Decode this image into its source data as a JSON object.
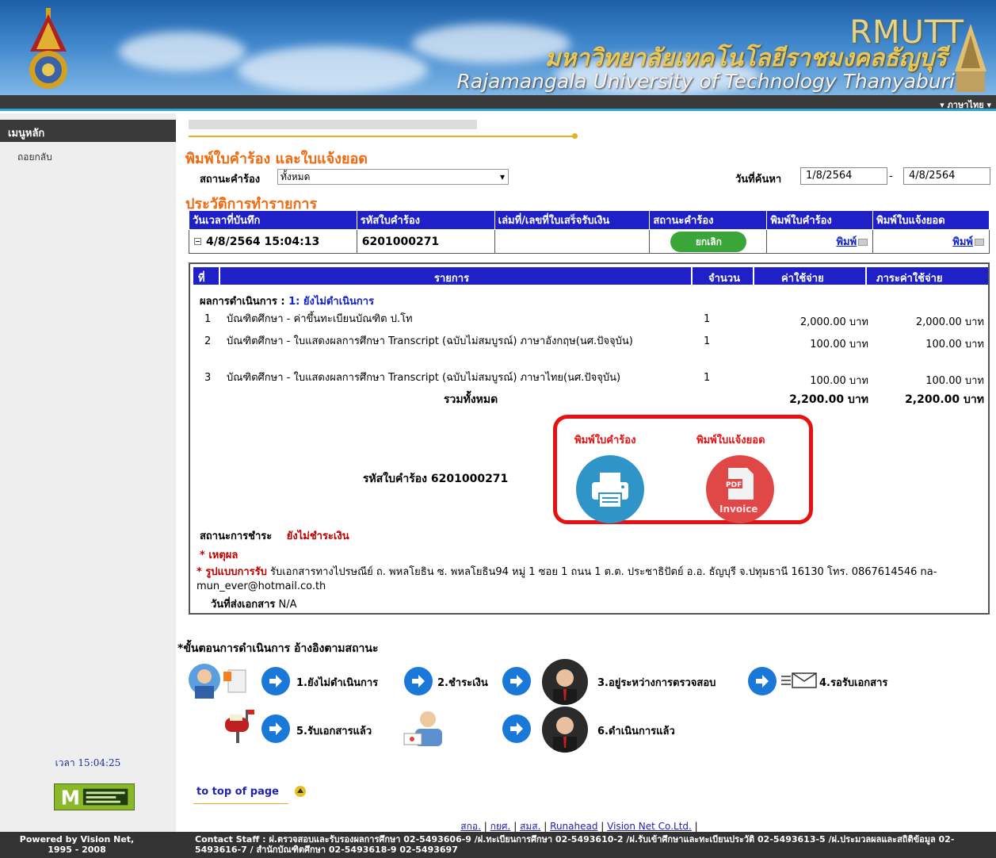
{
  "header": {
    "brand_short": "RMUTT",
    "brand_thai": "มหาวิทยาลัยเทคโนโลยีราชมงคลธัญบุรี",
    "brand_en": "Rajamangala University of Technology Thanyaburi",
    "language": "▾ ภาษาไทย ▾"
  },
  "sidebar": {
    "menu_title": "เมนูหลัก",
    "back": "ถอยกลับ",
    "clock": "เวลา 15:04:25"
  },
  "main": {
    "title": "พิมพ์ใบคำร้อง และใบแจ้งยอด",
    "filter": {
      "status_label": "สถานะคำร้อง",
      "status_value": "ทั้งหมด",
      "date_label": "วันที่ค้นหา",
      "date_from": "1/8/2564",
      "date_sep": "-",
      "date_to": "4/8/2564"
    },
    "history_title": "ประวัติการทำรายการ",
    "history_headers": [
      "วันเวลาที่บันทึก",
      "รหัสใบคำร้อง",
      "เล่มที่/เลขที่ใบเสร็จรับเงิน",
      "สถานะคำร้อง",
      "พิมพ์ใบคำร้อง",
      "พิมพ์ใบแจ้งยอด"
    ],
    "history_row": {
      "datetime": "4/8/2564 15:04:13",
      "request_id": "6201000271",
      "receipt": "",
      "cancel_label": "ยกเลิก",
      "print_request": "พิมพ์",
      "print_invoice": "พิมพ์"
    },
    "items_headers": [
      "ที่",
      "รายการ",
      "จำนวน",
      "ค่าใช้จ่าย",
      "ภาระค่าใช้จ่าย"
    ],
    "step_result_label": "ผลการดำเนินการ :",
    "step_result_value": "1: ยังไม่ดำเนินการ",
    "items": [
      {
        "no": "1",
        "desc": "บัณฑิตศึกษา - ค่าขึ้นทะเบียนบัณฑิต ป.โท",
        "qty": "1",
        "cost": "2,000.00 บาท",
        "total": "2,000.00 บาท"
      },
      {
        "no": "2",
        "desc": "บัณฑิตศึกษา - ใบแสดงผลการศึกษา Transcript (ฉบับไม่สมบูรณ์) ภาษาอังกฤษ(นศ.ปัจจุบัน)",
        "qty": "1",
        "cost": "100.00 บาท",
        "total": "100.00 บาท"
      },
      {
        "no": "3",
        "desc": "บัณฑิตศึกษา - ใบแสดงผลการศึกษา Transcript (ฉบับไม่สมบูรณ์) ภาษาไทย(นศ.ปัจจุบัน)",
        "qty": "1",
        "cost": "100.00 บาท",
        "total": "100.00 บาท"
      }
    ],
    "sum_label": "รวมทั้งหมด",
    "sum_cost": "2,200.00 บาท",
    "sum_total": "2,200.00 บาท",
    "request_code_text": "รหัสใบคำร้อง 6201000271",
    "print_request_label": "พิมพ์ใบคำร้อง",
    "print_invoice_label": "พิมพ์ใบแจ้งยอด",
    "pdf_text": "PDF",
    "invoice_text": "Invoice",
    "pay_status_label": "สถานะการชำระ",
    "pay_status_value": "ยังไม่ชำระเงิน",
    "reason_label": "* เหตุผล",
    "ship_label": "* รูปแบบการรับ",
    "ship_text": "รับเอกสารทางไปรษณีย์ ถ. พหลโยธิน ซ. พหลโยธิน94 หมู่ 1 ซอย 1 ถนน 1 ต.ต. ประชาธิปัตย์ อ.อ. ธัญบุรี จ.ปทุมธานี 16130 โทร. 0867614546 na-mun_ever@hotmail.co.th",
    "send_date_label": "วันที่ส่งเอกสาร",
    "send_date_value": "N/A",
    "process_title": "*ขั้นตอนการดำเนินการ อ้างอิงตามสถานะ",
    "steps": [
      "1.ยังไม่ดำเนินการ",
      "2.ชำระเงิน",
      "3.อยู่ระหว่างการตรวจสอบ",
      "4.รอรับเอกสาร",
      "5.รับเอกสารแล้ว",
      "6.ดำเนินการแล้ว"
    ],
    "top_link": "to top of page",
    "footer_links": [
      "สกอ.",
      "กยศ.",
      "สมส.",
      "Runahead",
      "Vision Net Co.Ltd."
    ],
    "footer_link_sep": "|"
  },
  "footer": {
    "left": "Powered by Vision Net, 1995 - 2008",
    "right": "Contact Staff : ฝ.ตรวจสอบและรับรองผลการศึกษา 02-5493606-9 /ฝ.ทะเบียนการศึกษา 02-5493610-2 /ฝ.รับเข้าศึกษาและทะเบียนประวัติ 02-5493613-5 /ฝ.ประมวลผลและสถิติข้อมูล 02-5493616-7 / สำนักบัณฑิตศึกษา 02-5493618-9 02-5493697"
  },
  "colors": {
    "accent_orange": "#f26a10",
    "table_header": "#2020c8",
    "highlight_red": "#e81010",
    "cancel_green": "#3aa63a"
  }
}
